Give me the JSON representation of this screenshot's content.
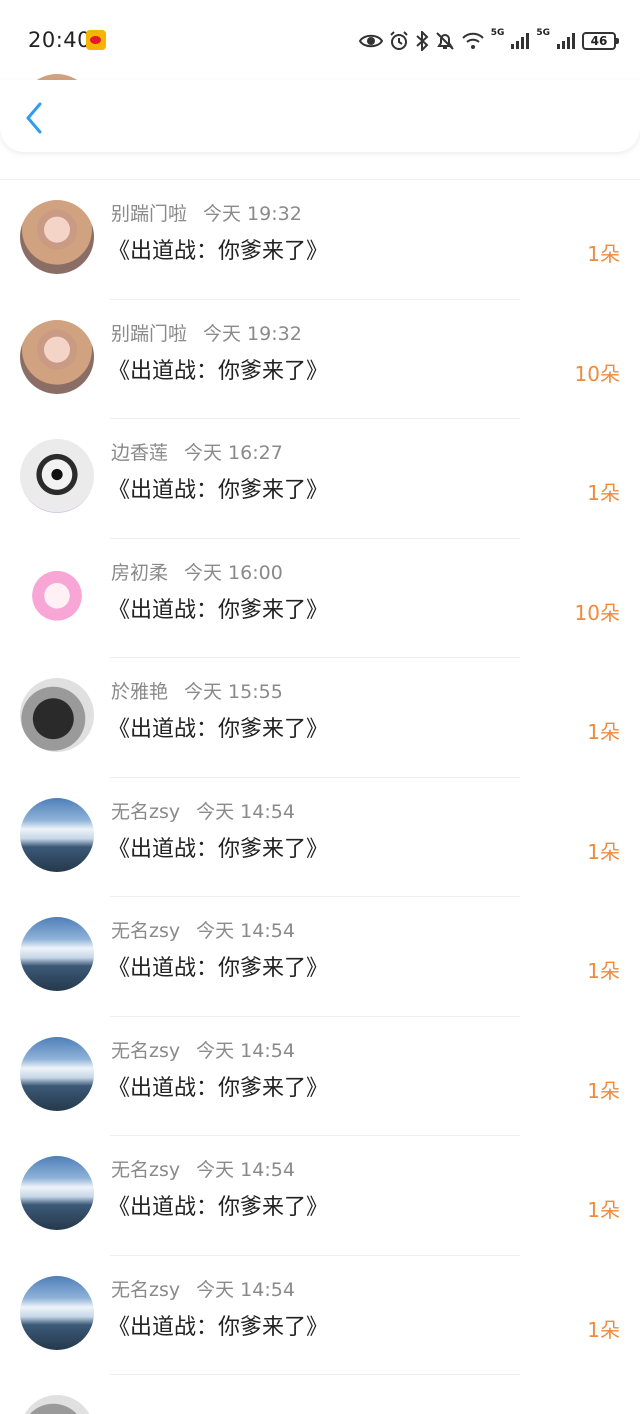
{
  "status_bar": {
    "time": "20:40",
    "battery": "46",
    "net_1": "5G",
    "net_2": "5G"
  },
  "nav": {
    "back_icon": "chevron-left-icon",
    "accent_color": "#2e9df0"
  },
  "colors": {
    "amount": "#f08a3c",
    "meta": "#8a8a8a"
  },
  "gifts": [
    {
      "name": "别踹门啦",
      "time": "今天 19:32",
      "title": "《出道战：你爹来了》",
      "amount": "1朵",
      "avatar": "pink"
    },
    {
      "name": "别踹门啦",
      "time": "今天 19:32",
      "title": "《出道战：你爹来了》",
      "amount": "10朵",
      "avatar": "pink"
    },
    {
      "name": "边香莲",
      "time": "今天 16:27",
      "title": "《出道战：你爹来了》",
      "amount": "1朵",
      "avatar": "mask"
    },
    {
      "name": "房初柔",
      "time": "今天 16:00",
      "title": "《出道战：你爹来了》",
      "amount": "10朵",
      "avatar": "anime"
    },
    {
      "name": "於雅艳",
      "time": "今天 15:55",
      "title": "《出道战：你爹来了》",
      "amount": "1朵",
      "avatar": "bw"
    },
    {
      "name": "无名zsy",
      "time": "今天 14:54",
      "title": "《出道战：你爹来了》",
      "amount": "1朵",
      "avatar": "sky"
    },
    {
      "name": "无名zsy",
      "time": "今天 14:54",
      "title": "《出道战：你爹来了》",
      "amount": "1朵",
      "avatar": "sky"
    },
    {
      "name": "无名zsy",
      "time": "今天 14:54",
      "title": "《出道战：你爹来了》",
      "amount": "1朵",
      "avatar": "sky"
    },
    {
      "name": "无名zsy",
      "time": "今天 14:54",
      "title": "《出道战：你爹来了》",
      "amount": "1朵",
      "avatar": "sky"
    },
    {
      "name": "无名zsy",
      "time": "今天 14:54",
      "title": "《出道战：你爹来了》",
      "amount": "1朵",
      "avatar": "sky"
    }
  ]
}
